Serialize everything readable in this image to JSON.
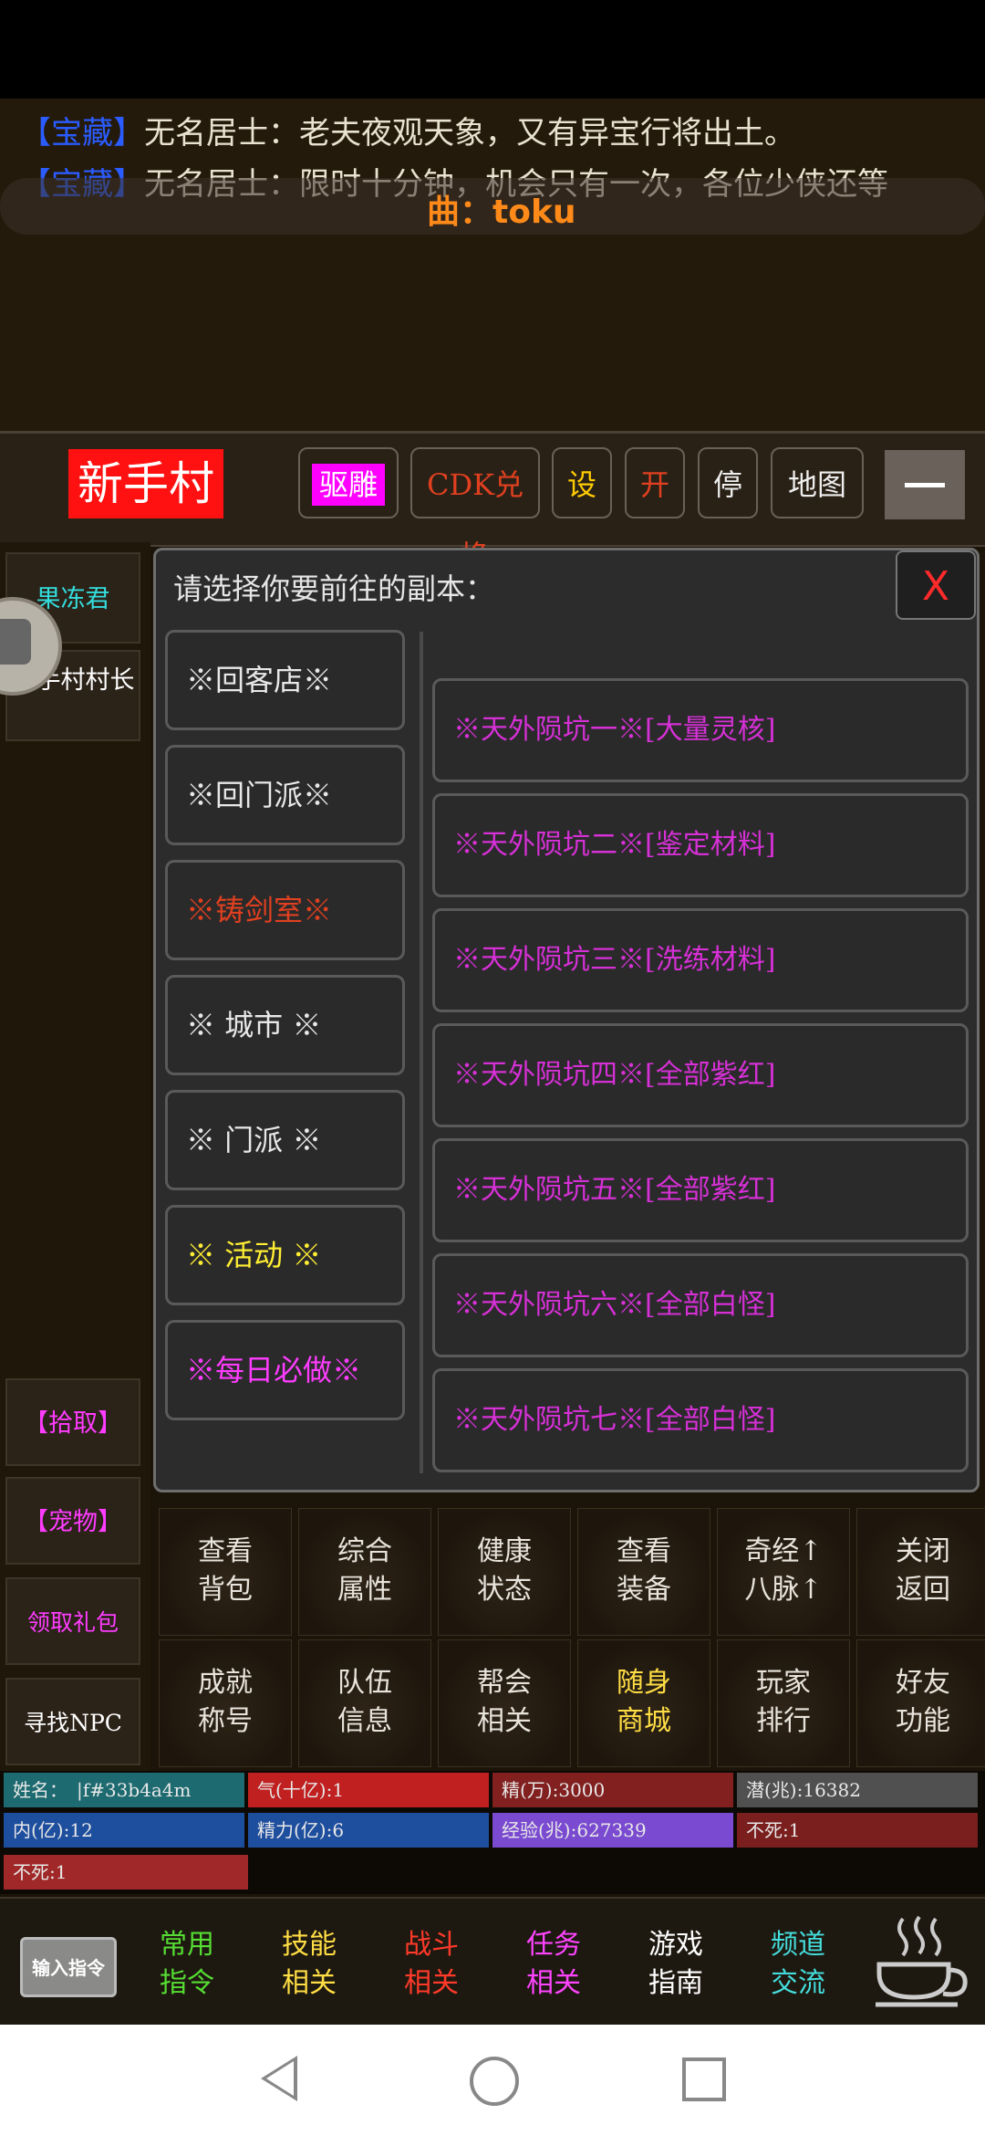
{
  "chat": {
    "line1": {
      "tag": "【宝藏】",
      "speaker": "无名居士：",
      "text": "老夫夜观天象，又有异宝行将出土。"
    },
    "line2": {
      "tag": "【宝藏】",
      "speaker": "无名居士：",
      "text": "限时十分钟，机会只有一次，各位少侠还等"
    },
    "music": "曲：toku"
  },
  "header": {
    "location": "新手村",
    "buttons": {
      "expel": "驱雕",
      "cdk": "CDK兑换",
      "settings": "设",
      "start": "开",
      "stop": "停",
      "map": "地图"
    }
  },
  "left_panel": {
    "npc1": "果冻君",
    "npc2": "新手村村长",
    "pick": "【拾取】",
    "pet": "【宠物】",
    "gift": "领取礼包",
    "find_npc": "寻找NPC"
  },
  "dialog": {
    "title": "请选择你要前往的副本：",
    "close": "X",
    "categories": [
      {
        "label": "※回客店※",
        "color": "#e8e8e8"
      },
      {
        "label": "※回门派※",
        "color": "#e8e8e8"
      },
      {
        "label": "※铸剑室※",
        "color": "#e04020"
      },
      {
        "label": "※ 城市 ※",
        "color": "#e8e8e8"
      },
      {
        "label": "※ 门派 ※",
        "color": "#e8e8e8"
      },
      {
        "label": "※ 活动 ※",
        "color": "#ffee33"
      },
      {
        "label": "※每日必做※",
        "color": "#ff3cff"
      }
    ],
    "dungeons": [
      "※天外陨坑一※[大量灵核]",
      "※天外陨坑二※[鉴定材料]",
      "※天外陨坑三※[洗练材料]",
      "※天外陨坑四※[全部紫红]",
      "※天外陨坑五※[全部紫红]",
      "※天外陨坑六※[全部白怪]",
      "※天外陨坑七※[全部白怪]"
    ]
  },
  "grid": {
    "row1": [
      "查看\n背包",
      "综合\n属性",
      "健康\n状态",
      "查看\n装备",
      "奇经↑\n八脉↑",
      "关闭\n返回"
    ],
    "row2": [
      "成就\n称号",
      "队伍\n信息",
      "帮会\n相关",
      "随身\n商城",
      "玩家\n排行",
      "好友\n功能"
    ]
  },
  "stats": {
    "name": "姓名：　|f#33b4a4m",
    "qi": "气(十亿):1",
    "jing": "精(万):3000",
    "qian": "潜(兆):16382",
    "nei": "内(亿):12",
    "jingli": "精力(亿):6",
    "exp": "经验(兆):627339",
    "busi1": "不死:1",
    "busi2": "不死:1"
  },
  "bottom": {
    "input": "输入指令",
    "buttons": [
      {
        "label": "常用\n指令",
        "color": "#55dd33"
      },
      {
        "label": "技能\n相关",
        "color": "#ffdd44"
      },
      {
        "label": "战斗\n相关",
        "color": "#ff3a2a"
      },
      {
        "label": "任务\n相关",
        "color": "#ff44ff"
      },
      {
        "label": "游戏\n指南",
        "color": "#ffffff"
      },
      {
        "label": "频道\n交流",
        "color": "#44dddd"
      }
    ]
  }
}
